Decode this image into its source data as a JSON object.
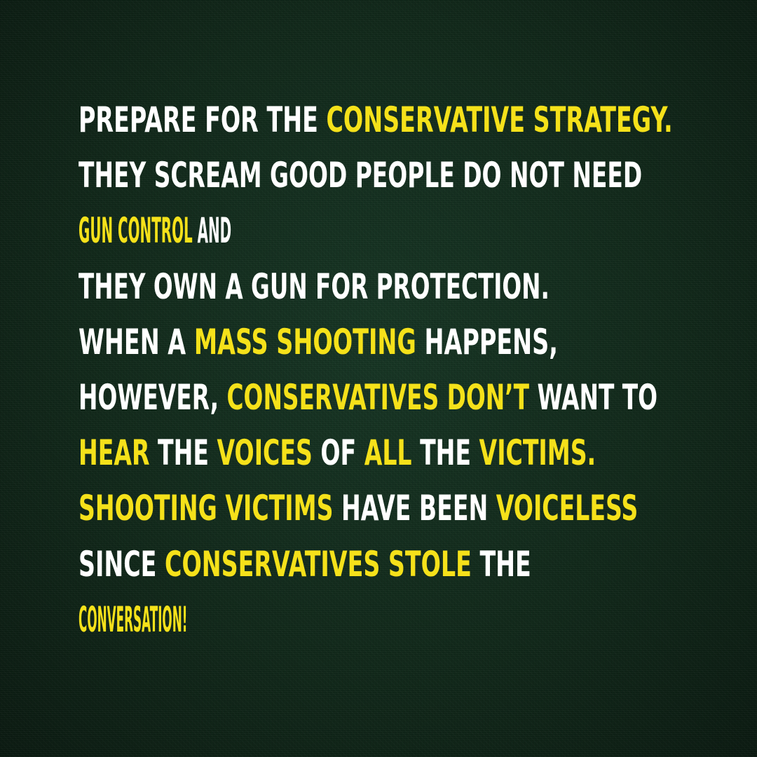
{
  "colors": {
    "background": "#11281a",
    "text_white": "#ffffff",
    "text_yellow": "#f5e11a"
  },
  "lines": [
    [
      {
        "text": "PREPARE FOR THE ",
        "color": "white"
      },
      {
        "text": "CONSERVATIVE STRATEGY.",
        "color": "yellow"
      }
    ],
    [
      {
        "text": "THEY SCREAM GOOD PEOPLE DO NOT NEED",
        "color": "white"
      }
    ],
    [
      {
        "text": "GUN CONTROL",
        "color": "yellow"
      },
      {
        "text": " AND",
        "color": "white"
      }
    ],
    [
      {
        "text": "THEY OWN A GUN FOR PROTECTION.",
        "color": "white"
      }
    ],
    [
      {
        "text": "WHEN A ",
        "color": "white"
      },
      {
        "text": "MASS SHOOTING",
        "color": "yellow"
      },
      {
        "text": " HAPPENS,",
        "color": "white"
      }
    ],
    [
      {
        "text": "HOWEVER, ",
        "color": "white"
      },
      {
        "text": "CONSERVATIVES DON’T",
        "color": "yellow"
      },
      {
        "text": " WANT TO",
        "color": "white"
      }
    ],
    [
      {
        "text": "HEAR",
        "color": "yellow"
      },
      {
        "text": " THE ",
        "color": "white"
      },
      {
        "text": "VOICES",
        "color": "yellow"
      },
      {
        "text": " OF ",
        "color": "white"
      },
      {
        "text": "ALL",
        "color": "yellow"
      },
      {
        "text": " THE ",
        "color": "white"
      },
      {
        "text": "VICTIMS.",
        "color": "yellow"
      }
    ],
    [
      {
        "text": "SHOOTING VICTIMS",
        "color": "yellow"
      },
      {
        "text": " HAVE BEEN ",
        "color": "white"
      },
      {
        "text": "VOICELESS",
        "color": "yellow"
      }
    ],
    [
      {
        "text": "SINCE ",
        "color": "white"
      },
      {
        "text": "CONSERVATIVES STOLE",
        "color": "yellow"
      },
      {
        "text": " THE",
        "color": "white"
      }
    ],
    [
      {
        "text": "CONVERSATION!",
        "color": "yellow"
      }
    ]
  ]
}
